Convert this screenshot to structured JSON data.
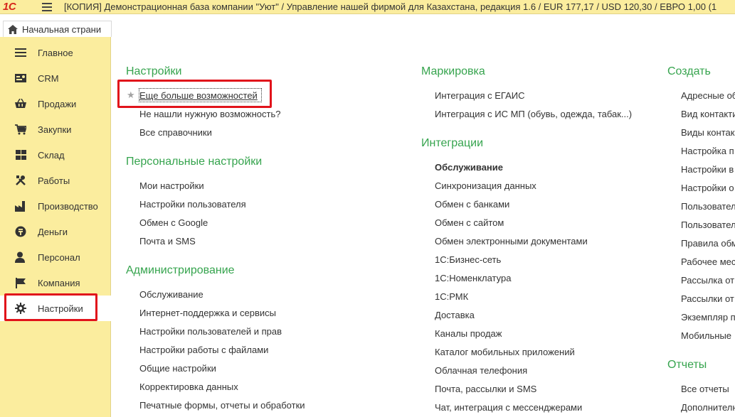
{
  "window": {
    "logo": "1С",
    "title": "[КОПИЯ] Демонстрационная база компании \"Уют\" / Управление нашей фирмой для Казахстана, редакция 1.6 / EUR 177,17 / USD 120,30 / ЕВРО 1,00  (1"
  },
  "tabs": {
    "home_label": "Начальная страни"
  },
  "sidebar": {
    "items": [
      {
        "label": "Главное",
        "icon": "menu-lines-icon"
      },
      {
        "label": "CRM",
        "icon": "contact-card-icon"
      },
      {
        "label": "Продажи",
        "icon": "basket-icon"
      },
      {
        "label": "Закупки",
        "icon": "cart-icon"
      },
      {
        "label": "Склад",
        "icon": "grid-boxes-icon"
      },
      {
        "label": "Работы",
        "icon": "tools-icon"
      },
      {
        "label": "Производство",
        "icon": "factory-icon"
      },
      {
        "label": "Деньги",
        "icon": "coin-icon"
      },
      {
        "label": "Персонал",
        "icon": "person-icon"
      },
      {
        "label": "Компания",
        "icon": "flag-icon"
      },
      {
        "label": "Настройки",
        "icon": "gear-icon"
      }
    ],
    "active_index": 10
  },
  "sections": {
    "nastroyki": {
      "title": "Настройки",
      "links": [
        "Еще больше возможностей",
        "Не нашли нужную возможность?",
        "Все справочники"
      ]
    },
    "personal": {
      "title": "Персональные настройки",
      "links": [
        "Мои настройки",
        "Настройки пользователя",
        "Обмен с Google",
        "Почта и SMS"
      ]
    },
    "admin": {
      "title": "Администрирование",
      "links": [
        "Обслуживание",
        "Интернет-поддержка и сервисы",
        "Настройки пользователей и прав",
        "Настройки работы с файлами",
        "Общие настройки",
        "Корректировка данных",
        "Печатные формы, отчеты и обработки"
      ]
    },
    "markirovka": {
      "title": "Маркировка",
      "links": [
        "Интеграция с ЕГАИС",
        "Интеграция с ИС МП (обувь, одежда, табак...)"
      ]
    },
    "integracii": {
      "title": "Интеграции",
      "links": [
        "Обслуживание",
        "Синхронизация данных",
        "Обмен с банками",
        "Обмен с сайтом",
        "Обмен электронными документами",
        "1С:Бизнес-сеть",
        "1С:Номенклатура",
        "1С:РМК",
        "Доставка",
        "Каналы продаж",
        "Каталог мобильных приложений",
        "Облачная телефония",
        "Почта, рассылки и SMS",
        "Чат, интеграция с мессенджерами"
      ]
    },
    "sozdat": {
      "title": "Создать",
      "links": [
        "Адресные об",
        "Вид контакти",
        "Виды контак",
        "Настройка п",
        "Настройки в",
        "Настройки о",
        "Пользовател",
        "Пользовател",
        "Правила обм",
        "Рабочее мес",
        "Рассылка от",
        "Рассылки от",
        "Экземпляр п",
        "Мобильные "
      ]
    },
    "otchety": {
      "title": "Отчеты",
      "links": [
        "Все отчеты",
        "Дополнителн"
      ]
    }
  },
  "colors": {
    "accent_green": "#36a44e",
    "panel_yellow": "#fbed9e",
    "highlight_red": "#e1131b"
  }
}
